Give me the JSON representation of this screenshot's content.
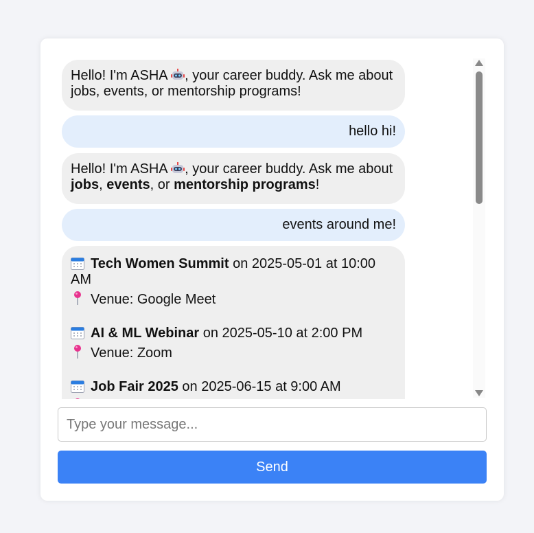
{
  "messages": [
    {
      "role": "bot",
      "pre": "Hello! I'm ASHA ",
      "post": ", your career buddy. Ask me about jobs, events, or mentorship programs!"
    },
    {
      "role": "user",
      "text": "hello hi!"
    },
    {
      "role": "bot",
      "pre": "Hello! I'm ASHA ",
      "mid1": ", your career buddy. Ask me about ",
      "b1": "jobs",
      "sep1": ", ",
      "b2": "events",
      "sep2": ", or ",
      "b3": "mentorship programs",
      "end": "!"
    },
    {
      "role": "user",
      "text": "events around me!"
    }
  ],
  "events": [
    {
      "title": "Tech Women Summit",
      "when": " on 2025-05-01 at 10:00 AM",
      "venue": "Venue: Google Meet"
    },
    {
      "title": "AI & ML Webinar",
      "when": " on 2025-05-10 at 2:00 PM",
      "venue": "Venue: Zoom"
    },
    {
      "title": "Job Fair 2025",
      "when": " on 2025-06-15 at 9:00 AM",
      "venue": ""
    }
  ],
  "input": {
    "placeholder": "Type your message..."
  },
  "send_label": "Send",
  "icons": {
    "bot": "robot-icon",
    "calendar": "calendar-icon",
    "venue": "pin-icon"
  },
  "colors": {
    "bot_bubble": "#efefef",
    "user_bubble": "#e3eefc",
    "send_button": "#3b82f6",
    "page_background": "#f3f4f8"
  }
}
